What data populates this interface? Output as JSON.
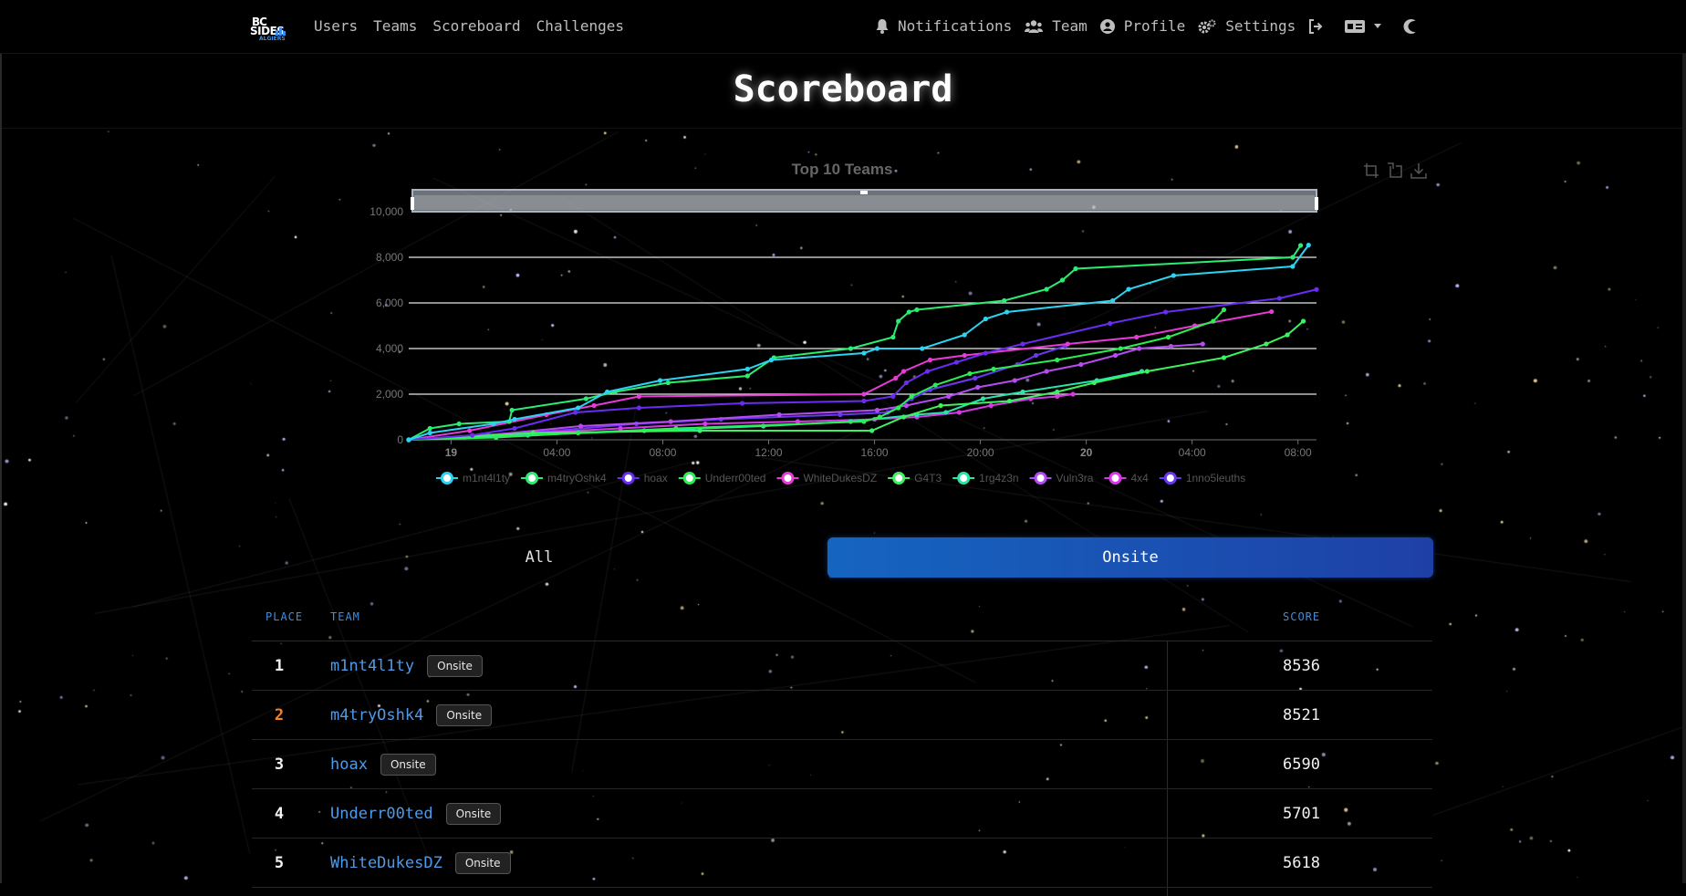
{
  "navbar": {
    "brand": {
      "line1": "BC",
      "line2": "SIDES",
      "line3": "ALGIERS"
    },
    "left_links": [
      "Users",
      "Teams",
      "Scoreboard",
      "Challenges"
    ],
    "right": {
      "notifications": "Notifications",
      "team": "Team",
      "profile": "Profile",
      "settings": "Settings"
    }
  },
  "page": {
    "title": "Scoreboard"
  },
  "brackets": {
    "all": "All",
    "onsite": "Onsite",
    "active": "onsite"
  },
  "table": {
    "headers": {
      "place": "PLACE",
      "team": "TEAM",
      "score": "SCORE"
    },
    "rows": [
      {
        "place": "1",
        "team": "m1nt4l1ty",
        "badge": "Onsite",
        "score": "8536"
      },
      {
        "place": "2",
        "team": "m4tryOshk4",
        "badge": "Onsite",
        "score": "8521"
      },
      {
        "place": "3",
        "team": "hoax",
        "badge": "Onsite",
        "score": "6590"
      },
      {
        "place": "4",
        "team": "Underr00ted",
        "badge": "Onsite",
        "score": "5701"
      },
      {
        "place": "5",
        "team": "WhiteDukesDZ",
        "badge": "Onsite",
        "score": "5618"
      }
    ]
  },
  "chart_data": {
    "type": "line",
    "title": "Top 10 Teams",
    "ylim": [
      0,
      10000
    ],
    "y_ticks": [
      0,
      2000,
      4000,
      6000,
      8000,
      10000
    ],
    "y_tick_labels": [
      "0",
      "2,000",
      "4,000",
      "6,000",
      "8,000",
      "10,000"
    ],
    "x_range_hours": [
      -1.6,
      32.7
    ],
    "x_ticks": [
      {
        "h": 0,
        "label": "19",
        "bold": true
      },
      {
        "h": 4,
        "label": "04:00"
      },
      {
        "h": 8,
        "label": "08:00"
      },
      {
        "h": 12,
        "label": "12:00"
      },
      {
        "h": 16,
        "label": "16:00"
      },
      {
        "h": 20,
        "label": "20:00"
      },
      {
        "h": 24,
        "label": "20",
        "bold": true
      },
      {
        "h": 28,
        "label": "04:00"
      },
      {
        "h": 32,
        "label": "08:00"
      }
    ],
    "legend_position": "bottom",
    "series": [
      {
        "name": "m1nt4l1ty",
        "color": "#2ad4f2",
        "points": [
          [
            -1.6,
            0
          ],
          [
            -0.8,
            300
          ],
          [
            1.6,
            700
          ],
          [
            2.4,
            900
          ],
          [
            4.8,
            1400
          ],
          [
            5.9,
            2100
          ],
          [
            7.9,
            2600
          ],
          [
            11.2,
            3100
          ],
          [
            12.1,
            3500
          ],
          [
            15.6,
            3800
          ],
          [
            16.1,
            4000
          ],
          [
            17.8,
            4000
          ],
          [
            19.4,
            4600
          ],
          [
            20.2,
            5300
          ],
          [
            21.0,
            5600
          ],
          [
            25.0,
            6100
          ],
          [
            25.6,
            6600
          ],
          [
            27.3,
            7200
          ],
          [
            31.8,
            7600
          ],
          [
            32.4,
            8536
          ]
        ]
      },
      {
        "name": "m4tryOshk4",
        "color": "#2aee72",
        "points": [
          [
            -1.6,
            0
          ],
          [
            -0.8,
            500
          ],
          [
            0.3,
            700
          ],
          [
            2.2,
            800
          ],
          [
            2.3,
            1300
          ],
          [
            5.1,
            1800
          ],
          [
            6.2,
            2100
          ],
          [
            8.2,
            2500
          ],
          [
            11.2,
            2800
          ],
          [
            12.2,
            3600
          ],
          [
            15.1,
            4000
          ],
          [
            16.7,
            4500
          ],
          [
            16.9,
            5200
          ],
          [
            17.3,
            5600
          ],
          [
            17.6,
            5700
          ],
          [
            20.9,
            6100
          ],
          [
            22.5,
            6600
          ],
          [
            23.1,
            7000
          ],
          [
            23.6,
            7500
          ],
          [
            31.8,
            8000
          ],
          [
            32.1,
            8521
          ]
        ]
      },
      {
        "name": "hoax",
        "color": "#6a2cf2",
        "points": [
          [
            -1.6,
            0
          ],
          [
            0.8,
            200
          ],
          [
            2.4,
            500
          ],
          [
            4.7,
            1200
          ],
          [
            7.1,
            1400
          ],
          [
            11.0,
            1600
          ],
          [
            15.6,
            1700
          ],
          [
            16.7,
            1900
          ],
          [
            17.2,
            2500
          ],
          [
            18.0,
            3000
          ],
          [
            19.1,
            3400
          ],
          [
            20.2,
            3800
          ],
          [
            21.6,
            4200
          ],
          [
            24.9,
            5100
          ],
          [
            27.0,
            5600
          ],
          [
            31.3,
            6200
          ],
          [
            32.7,
            6590
          ]
        ]
      },
      {
        "name": "Underr00ted",
        "color": "#2aee52",
        "points": [
          [
            -1.6,
            0
          ],
          [
            1.7,
            100
          ],
          [
            4.8,
            300
          ],
          [
            8.5,
            500
          ],
          [
            15.6,
            800
          ],
          [
            16.2,
            1000
          ],
          [
            16.9,
            1400
          ],
          [
            17.4,
            1900
          ],
          [
            18.3,
            2400
          ],
          [
            19.6,
            2900
          ],
          [
            20.5,
            3100
          ],
          [
            22.9,
            3500
          ],
          [
            25.3,
            4000
          ],
          [
            27.1,
            4500
          ],
          [
            28.8,
            5200
          ],
          [
            29.2,
            5701
          ]
        ]
      },
      {
        "name": "WhiteDukesDZ",
        "color": "#e83ad7",
        "points": [
          [
            -1.6,
            0
          ],
          [
            0.7,
            400
          ],
          [
            3.6,
            1100
          ],
          [
            5.4,
            1500
          ],
          [
            7.1,
            1900
          ],
          [
            15.6,
            2000
          ],
          [
            16.8,
            2700
          ],
          [
            17.1,
            3000
          ],
          [
            18.1,
            3500
          ],
          [
            19.4,
            3700
          ],
          [
            23.3,
            4200
          ],
          [
            25.9,
            4500
          ],
          [
            28.1,
            5000
          ],
          [
            31.0,
            5618
          ]
        ]
      },
      {
        "name": "G4T3",
        "color": "#3cf25f",
        "points": [
          [
            -1.6,
            0
          ],
          [
            3.1,
            300
          ],
          [
            9.4,
            400
          ],
          [
            15.9,
            400
          ],
          [
            17.1,
            1000
          ],
          [
            18.5,
            1500
          ],
          [
            21.1,
            1700
          ],
          [
            22.9,
            2100
          ],
          [
            24.3,
            2500
          ],
          [
            26.3,
            3000
          ],
          [
            29.2,
            3600
          ],
          [
            30.8,
            4200
          ],
          [
            31.6,
            4600
          ],
          [
            32.2,
            5200
          ]
        ]
      },
      {
        "name": "1rg4z3n",
        "color": "#27e6a8",
        "points": [
          [
            -1.6,
            0
          ],
          [
            2.9,
            200
          ],
          [
            7.3,
            400
          ],
          [
            11.8,
            600
          ],
          [
            15.1,
            800
          ],
          [
            17.6,
            1100
          ],
          [
            18.7,
            1200
          ],
          [
            20.1,
            1800
          ],
          [
            21.6,
            2100
          ],
          [
            24.4,
            2600
          ],
          [
            26.1,
            3000
          ]
        ]
      },
      {
        "name": "Vuln3ra",
        "color": "#b54cf0",
        "points": [
          [
            -1.6,
            0
          ],
          [
            1.4,
            200
          ],
          [
            4.9,
            600
          ],
          [
            8.3,
            800
          ],
          [
            12.4,
            1100
          ],
          [
            16.1,
            1300
          ],
          [
            17.2,
            1500
          ],
          [
            18.8,
            1900
          ],
          [
            19.9,
            2300
          ],
          [
            21.3,
            2600
          ],
          [
            22.5,
            3000
          ],
          [
            23.8,
            3300
          ],
          [
            25.1,
            3700
          ],
          [
            26.0,
            4000
          ],
          [
            27.2,
            4100
          ],
          [
            28.4,
            4200
          ]
        ]
      },
      {
        "name": "4x4",
        "color": "#d838e8",
        "points": [
          [
            -1.6,
            0
          ],
          [
            0.5,
            100
          ],
          [
            3.2,
            300
          ],
          [
            6.4,
            500
          ],
          [
            9.6,
            700
          ],
          [
            13.1,
            800
          ],
          [
            16.0,
            900
          ],
          [
            17.6,
            1000
          ],
          [
            19.2,
            1200
          ],
          [
            20.4,
            1500
          ],
          [
            21.9,
            1800
          ],
          [
            22.9,
            1900
          ],
          [
            23.5,
            2000
          ]
        ]
      },
      {
        "name": "1nno5leuths",
        "color": "#6b38f2",
        "points": [
          [
            -1.6,
            0
          ],
          [
            1.1,
            200
          ],
          [
            3.9,
            400
          ],
          [
            7.0,
            700
          ],
          [
            10.2,
            900
          ],
          [
            14.7,
            1100
          ],
          [
            16.5,
            1200
          ],
          [
            17.4,
            1800
          ],
          [
            18.1,
            2200
          ],
          [
            19.8,
            2700
          ],
          [
            21.4,
            3300
          ],
          [
            22.1,
            3700
          ],
          [
            23.2,
            4100
          ]
        ]
      }
    ]
  }
}
